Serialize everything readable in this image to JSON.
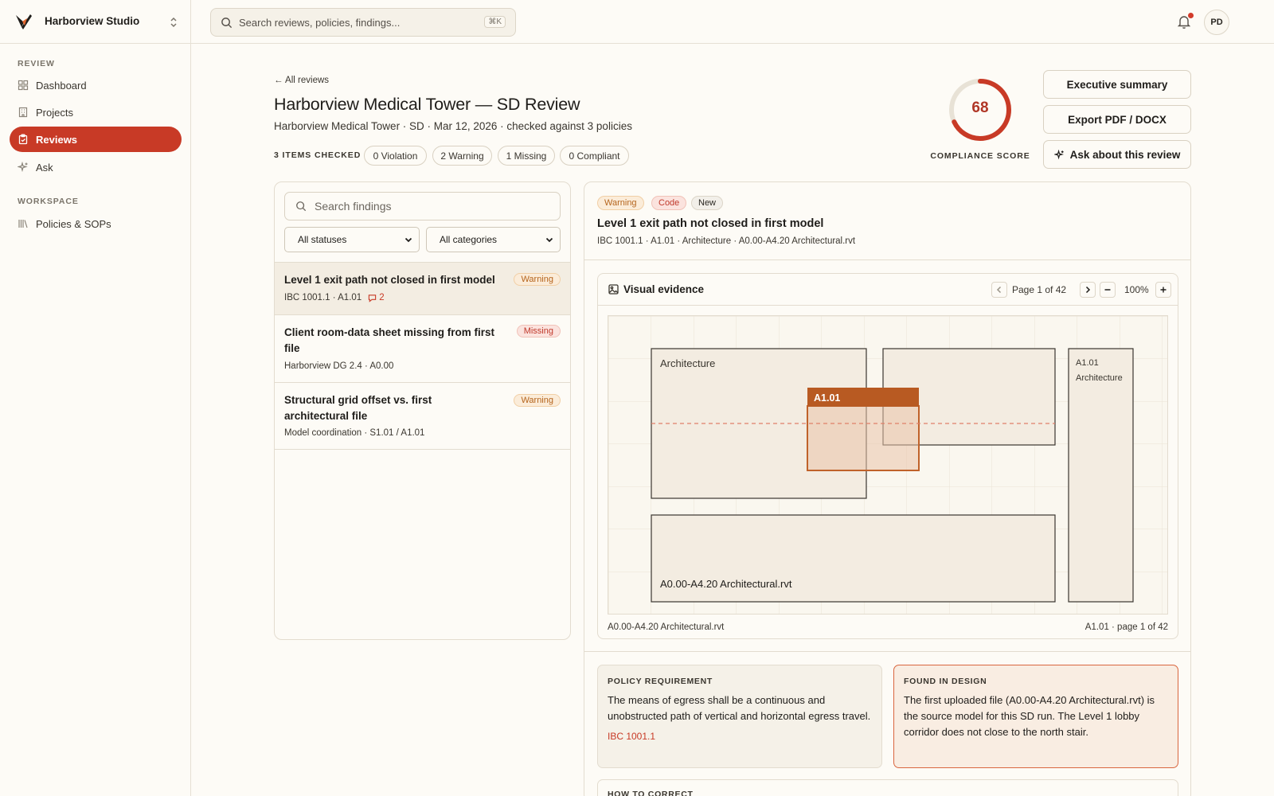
{
  "brand": {
    "name": "Harborview Studio"
  },
  "search": {
    "placeholder": "Search reviews, policies, findings...",
    "shortcut": "⌘K"
  },
  "sidebar": {
    "sections": [
      {
        "label": "REVIEW"
      },
      {
        "label": "WORKSPACE"
      }
    ],
    "items": [
      {
        "label": "Dashboard",
        "icon": "grid-icon"
      },
      {
        "label": "Projects",
        "icon": "building-icon"
      },
      {
        "label": "Reviews",
        "icon": "clipboard-icon",
        "active": true
      },
      {
        "label": "Ask",
        "icon": "sparkle-icon"
      },
      {
        "label": "Policies & SOPs",
        "icon": "library-icon"
      }
    ]
  },
  "user": {
    "initials": "PD",
    "has_notification": true
  },
  "header": {
    "back_link": "← All reviews",
    "title": "Harborview Medical Tower — SD Review",
    "subtitle": "Harborview Medical Tower · SD · Mar 12, 2026 · checked against 3 policies",
    "items_checked": "3 ITEMS CHECKED",
    "pills": [
      "0 Violation",
      "2 Warning",
      "1 Missing",
      "0 Compliant"
    ]
  },
  "score": {
    "value": 68,
    "max": 100,
    "label": "COMPLIANCE SCORE",
    "color": "#c83a26"
  },
  "actions": {
    "executive_summary": "Executive summary",
    "export": "Export PDF / DOCX",
    "ask": "Ask about this review"
  },
  "findings": {
    "search_placeholder": "Search findings",
    "status_filter": "All statuses",
    "category_filter": "All categories",
    "items": [
      {
        "title": "Level 1 exit path not closed in first model",
        "meta": "IBC 1001.1 · A1.01",
        "comments": "2",
        "status": "Warning"
      },
      {
        "title": "Client room-data sheet missing from first file",
        "meta": "Harborview DG 2.4 · A0.00",
        "status": "Missing"
      },
      {
        "title": "Structural grid offset vs. first architectural file",
        "meta": "Model coordination · S1.01 / A1.01",
        "status": "Warning"
      }
    ]
  },
  "detail": {
    "tags": [
      "Warning",
      "Code",
      "New"
    ],
    "title": "Level 1 exit path not closed in first model",
    "meta": "IBC 1001.1 · A1.01 · Architecture · A0.00-A4.20 Architectural.rvt",
    "evidence": {
      "title": "Visual evidence",
      "page": "Page 1 of 42",
      "zoom": "100%",
      "labels": {
        "architecture": "Architecture",
        "highlight": "A1.01",
        "side_sheet": "A1.01",
        "side_discipline": "Architecture",
        "file": "A0.00-A4.20 Architectural.rvt"
      },
      "footer_left": "A0.00-A4.20 Architectural.rvt",
      "footer_right": "A1.01 · page 1 of 42"
    },
    "policy": {
      "label": "POLICY REQUIREMENT",
      "text": "The means of egress shall be a continuous and unobstructed path of vertical and horizontal egress travel.",
      "ref": "IBC 1001.1"
    },
    "found": {
      "label": "FOUND IN DESIGN",
      "text": "The first uploaded file (A0.00-A4.20 Architectural.rvt) is the source model for this SD run. The Level 1 lobby corridor does not close to the north stair."
    },
    "fix": {
      "label": "HOW TO CORRECT"
    }
  }
}
